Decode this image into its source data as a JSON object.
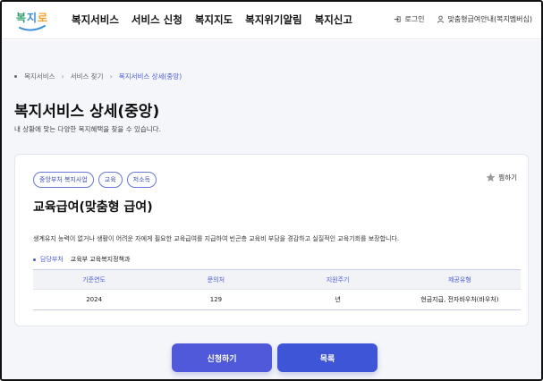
{
  "header": {
    "logo_text": "복지로",
    "nav": [
      "복지서비스",
      "서비스 신청",
      "복지지도",
      "복지위기알림",
      "복지신고"
    ],
    "login": "로그인",
    "member": "맞춤형급여안내(복지멤버십)"
  },
  "breadcrumb": [
    "복지서비스",
    "서비스 찾기",
    "복지서비스 상세(중앙)"
  ],
  "page": {
    "title": "복지서비스 상세(중앙)",
    "description": "내 상황에 맞는 다양한 복지혜택을 찾을 수 있습니다."
  },
  "service": {
    "tags": [
      "중앙부처 복지사업",
      "교육",
      "저소득"
    ],
    "favorite_label": "찜하기",
    "title": "교육급여(맞춤형 급여)",
    "description": "생계유지 능력이 없거나 생활이 어려운 자에게 필요한 교육급여를 지급하여 빈곤층 교육비 부담을 경감하고 실질적인 교육기회를 보장합니다.",
    "department_label": "담당부처",
    "department_value": "교육부 교육복지정책과",
    "table": {
      "headers": [
        "기준연도",
        "문의처",
        "지원주기",
        "제공유형"
      ],
      "row": [
        "2024",
        "129",
        "년",
        "현금지급, 전자바우처(바우처)"
      ]
    }
  },
  "buttons": {
    "apply": "신청하기",
    "list": "목록"
  },
  "colors": {
    "accent": "#4a5bd4",
    "button_apply": "#4f59d9",
    "button_list": "#3d55d6",
    "background": "#f4f6fa"
  }
}
